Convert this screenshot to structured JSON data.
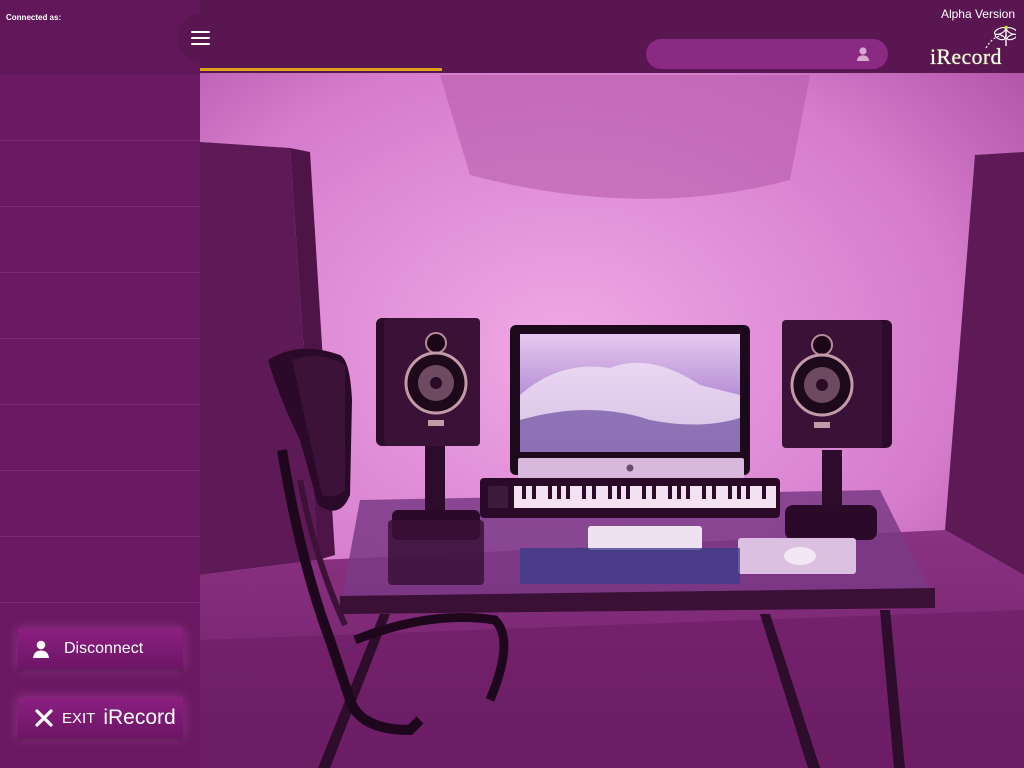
{
  "sidebar": {
    "connected_label": "Connected as:",
    "rows": 8,
    "disconnect_label": "Disconnect",
    "exit_prefix": "EXIT",
    "exit_name": "iRecord"
  },
  "header": {
    "version_label": "Alpha Version",
    "logo_text": "iRecord",
    "search": {
      "value": "",
      "placeholder": ""
    }
  },
  "colors": {
    "sidebar": "#6b1962",
    "topbar": "#5a1650",
    "accent": "#e0a21a",
    "search_bg": "#8a2a82",
    "logo_green": "#c8e24a"
  },
  "icons": {
    "menu": "hamburger-icon",
    "search_user": "user-icon",
    "disconnect": "user-icon",
    "exit": "close-icon",
    "logo": "dragonfly-icon"
  },
  "progress": 0.24
}
